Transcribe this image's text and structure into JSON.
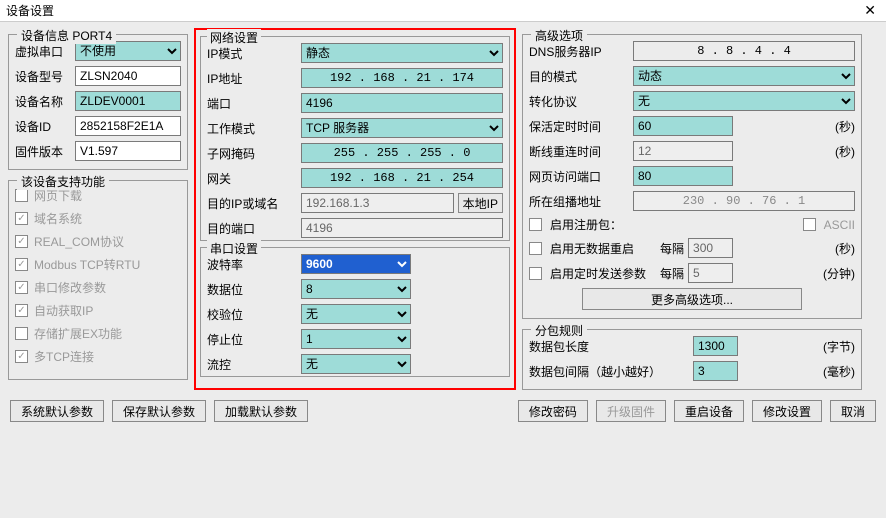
{
  "window": {
    "title": "设备设置",
    "close": "✕"
  },
  "devinfo": {
    "legend": "设备信息 PORT4",
    "virtual_serial_label": "虚拟串口",
    "virtual_serial_value": "不使用",
    "model_label": "设备型号",
    "model_value": "ZLSN2040",
    "name_label": "设备名称",
    "name_value": "ZLDEV0001",
    "id_label": "设备ID",
    "id_value": "2852158F2E1A",
    "fw_label": "固件版本",
    "fw_value": "V1.597"
  },
  "features": {
    "legend": "该设备支持功能",
    "web_download": "网页下载",
    "dns": "域名系统",
    "realcom": "REAL_COM协议",
    "modbus": "Modbus TCP转RTU",
    "serial_mod": "串口修改参数",
    "auto_ip": "自动获取IP",
    "storage_ex": "存储扩展EX功能",
    "multi_tcp": "多TCP连接"
  },
  "net": {
    "legend": "网络设置",
    "ip_mode_label": "IP模式",
    "ip_mode_value": "静态",
    "ip_addr_label": "IP地址",
    "ip_addr": "192  . 168  .  21  . 174",
    "port_label": "端口",
    "port_value": "4196",
    "work_mode_label": "工作模式",
    "work_mode_value": "TCP 服务器",
    "mask_label": "子网掩码",
    "mask": "255  . 255  . 255  .  0",
    "gw_label": "网关",
    "gw": "192  . 168  .  21  . 254",
    "dest_ip_label": "目的IP或域名",
    "dest_ip_value": "192.168.1.3",
    "local_ip_btn": "本地IP",
    "dest_port_label": "目的端口",
    "dest_port_value": "4196"
  },
  "serial": {
    "legend": "串口设置",
    "baud_label": "波特率",
    "baud_value": "9600",
    "data_label": "数据位",
    "data_value": "8",
    "parity_label": "校验位",
    "parity_value": "无",
    "stop_label": "停止位",
    "stop_value": "1",
    "flow_label": "流控",
    "flow_value": "无"
  },
  "adv": {
    "legend": "高级选项",
    "dns_label": "DNS服务器IP",
    "dns": "8  .  8  .  4  .  4",
    "dest_mode_label": "目的模式",
    "dest_mode_value": "动态",
    "proto_label": "转化协议",
    "proto_value": "无",
    "keepalive_label": "保活定时时间",
    "keepalive_value": "60",
    "keepalive_unit": "(秒)",
    "reconnect_label": "断线重连时间",
    "reconnect_value": "12",
    "reconnect_unit": "(秒)",
    "webport_label": "网页访问端口",
    "webport_value": "80",
    "multicast_label": "所在组播地址",
    "multicast": "230  .  90  .  76  .  1",
    "reg_pkt_label": "启用注册包：",
    "ascii_label": "ASCII",
    "nodata_label": "启用无数据重启",
    "nodata_every": "每隔",
    "nodata_value": "300",
    "nodata_unit": "(秒)",
    "timed_label": "启用定时发送参数",
    "timed_every": "每隔",
    "timed_value": "5",
    "timed_unit": "(分钟)",
    "more_btn": "更多高级选项..."
  },
  "pkt": {
    "legend": "分包规则",
    "len_label": "数据包长度",
    "len_value": "1300",
    "len_unit": "(字节)",
    "interval_label": "数据包间隔（越小越好）",
    "interval_value": "3",
    "interval_unit": "(毫秒)"
  },
  "buttons": {
    "sys_default": "系统默认参数",
    "save_default": "保存默认参数",
    "load_default": "加载默认参数",
    "change_pw": "修改密码",
    "upgrade_fw": "升级固件",
    "reboot": "重启设备",
    "apply": "修改设置",
    "cancel": "取消"
  }
}
